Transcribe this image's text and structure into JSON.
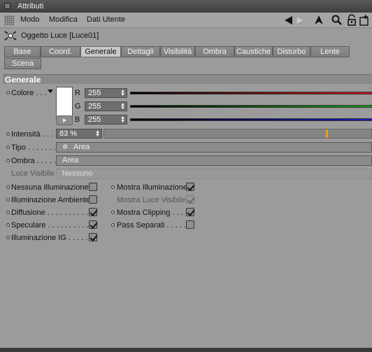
{
  "window": {
    "title": "Attributi"
  },
  "menu": {
    "items": [
      "Modo",
      "Modifica",
      "Dati Utente"
    ]
  },
  "object": {
    "title": "Oggetto Luce [Luce01]"
  },
  "tabs": {
    "row1": [
      "Base",
      "Coord.",
      "Generale",
      "Dettagli",
      "Visibilità",
      "Ombra",
      "Caustiche",
      "Disturbo",
      "Lente"
    ],
    "row2": [
      "Scena"
    ],
    "active": "Generale"
  },
  "section": {
    "title": "Generale"
  },
  "color": {
    "label": "Colore . . .",
    "r_label": "R",
    "r_value": "255",
    "g_label": "G",
    "g_value": "255",
    "b_label": "B",
    "b_value": "255",
    "r_color": "#d01818",
    "g_color": "#18a018",
    "b_color": "#1818c0"
  },
  "intensity": {
    "label": "Intensità . . .",
    "value": "83 %",
    "level": 0.83,
    "accent": "#e8a020"
  },
  "tipo": {
    "label": "Tipo . . . . . . .",
    "value": "Area"
  },
  "ombra": {
    "label": "Ombra . . . . .",
    "value": "Area"
  },
  "luce_visibile": {
    "label": "Luce Visibile",
    "value": "Nessuno"
  },
  "checks": {
    "left": [
      {
        "label": "Nessuna Illuminazione",
        "checked": false
      },
      {
        "label": "Illuminazione Ambiente",
        "checked": false
      },
      {
        "label": "Diffusione . . . . . . . . . .",
        "checked": true
      },
      {
        "label": "Speculare . . . . . . . . . . .",
        "checked": true
      },
      {
        "label": "Illuminazione IG . . . . .",
        "checked": true
      }
    ],
    "right": [
      {
        "label": "Mostra Illuminazione",
        "checked": true
      },
      {
        "label": "Mostra Luce Visibile",
        "checked": true
      },
      {
        "label": "Mostra Clipping . . . .",
        "checked": true
      },
      {
        "label": "Pass Separati . . . . .",
        "checked": false
      }
    ]
  }
}
